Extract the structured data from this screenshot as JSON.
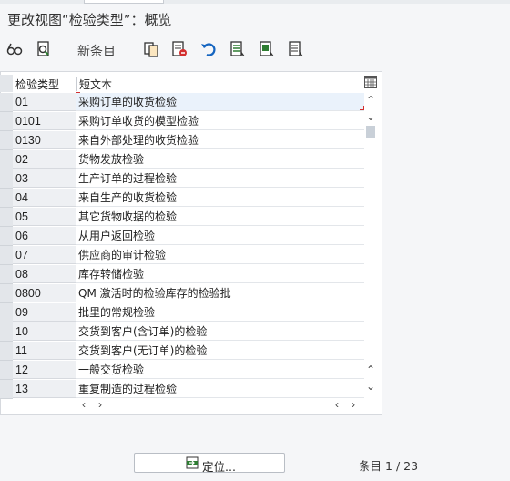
{
  "title": "更改视图“检验类型”：概览",
  "toolbar": {
    "new_entries_label": "新条目",
    "icons": [
      "glasses-icon",
      "display-change-icon",
      "copy-icon",
      "delete-icon",
      "undo-icon",
      "select-all-icon",
      "select-block-icon",
      "deselect-all-icon"
    ]
  },
  "table": {
    "headers": [
      "检验类型",
      "短文本"
    ],
    "rows": [
      {
        "key": "01",
        "text": "采购订单的收货检验"
      },
      {
        "key": "0101",
        "text": "采购订单收货的模型检验"
      },
      {
        "key": "0130",
        "text": "来自外部处理的收货检验"
      },
      {
        "key": "02",
        "text": "货物发放检验"
      },
      {
        "key": "03",
        "text": "生产订单的过程检验"
      },
      {
        "key": "04",
        "text": "来自生产的收货检验"
      },
      {
        "key": "05",
        "text": "其它货物收据的检验"
      },
      {
        "key": "06",
        "text": "从用户返回检验"
      },
      {
        "key": "07",
        "text": "供应商的审计检验"
      },
      {
        "key": "08",
        "text": "库存转储检验"
      },
      {
        "key": "0800",
        "text": "QM 激活时的检验库存的检验批"
      },
      {
        "key": "09",
        "text": "批里的常规检验"
      },
      {
        "key": "10",
        "text": "交货到客户(含订单)的检验"
      },
      {
        "key": "11",
        "text": "交货到客户(无订单)的检验"
      },
      {
        "key": "12",
        "text": "一般交货检验"
      },
      {
        "key": "13",
        "text": "重复制造的过程检验"
      }
    ]
  },
  "footer": {
    "position_button_label": "定位...",
    "entry_label": "条目",
    "entry_current": "1",
    "entry_sep": "/",
    "entry_total": "23"
  },
  "colors": {
    "accent_red": "#d32f2f",
    "selection_blue": "#eaf2fb"
  }
}
